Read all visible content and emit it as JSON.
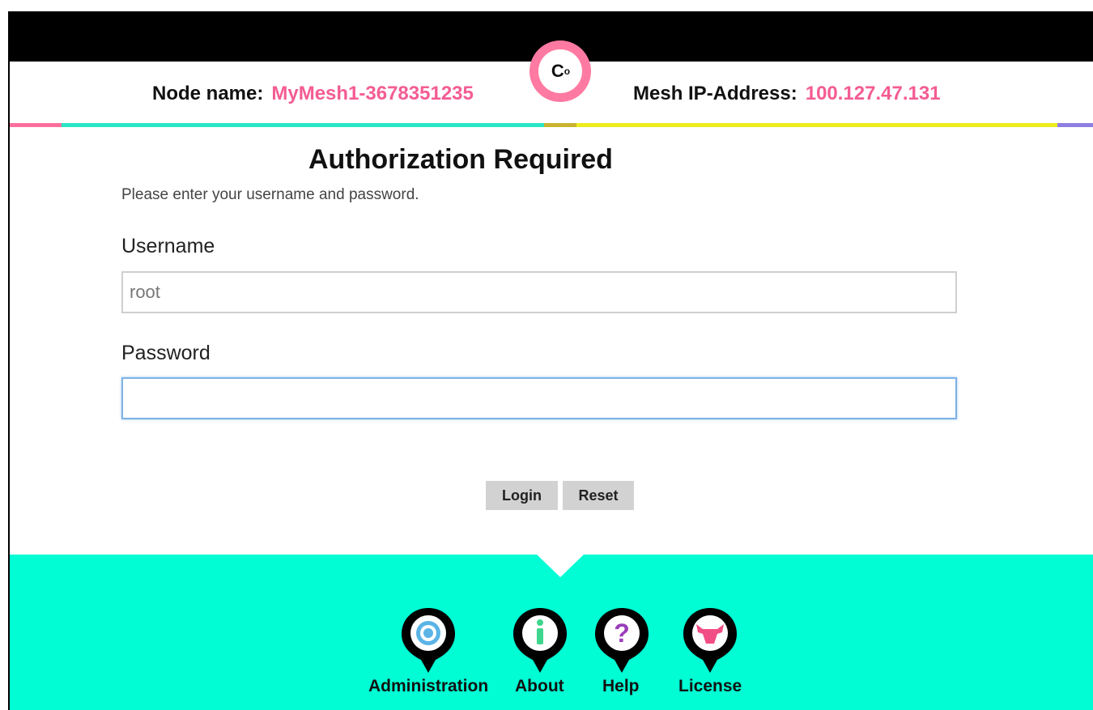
{
  "header": {
    "logo_text": "C",
    "logo_sub": "o",
    "node_label": "Node name:",
    "node_value": "MyMesh1-3678351235",
    "mesh_label": "Mesh IP-Address:",
    "mesh_value": "100.127.47.131"
  },
  "colors": {
    "accent_pink": "#f45c93",
    "footer_bg": "#00fdd4",
    "stripe_pink": "#ff6f9b",
    "stripe_teal": "#29e6c6",
    "stripe_olive": "#c9b430",
    "stripe_yellow": "#eded1e",
    "stripe_purple": "#8f7ee0"
  },
  "login": {
    "title": "Authorization Required",
    "subtitle": "Please enter your username and password.",
    "username_label": "Username",
    "username_value": "root",
    "password_label": "Password",
    "password_value": "",
    "login_button": "Login",
    "reset_button": "Reset"
  },
  "footer": {
    "items": [
      {
        "label": "Administration",
        "icon": "admin-target-icon"
      },
      {
        "label": "About",
        "icon": "info-icon"
      },
      {
        "label": "Help",
        "icon": "help-question-icon"
      },
      {
        "label": "License",
        "icon": "license-bull-icon"
      }
    ]
  }
}
